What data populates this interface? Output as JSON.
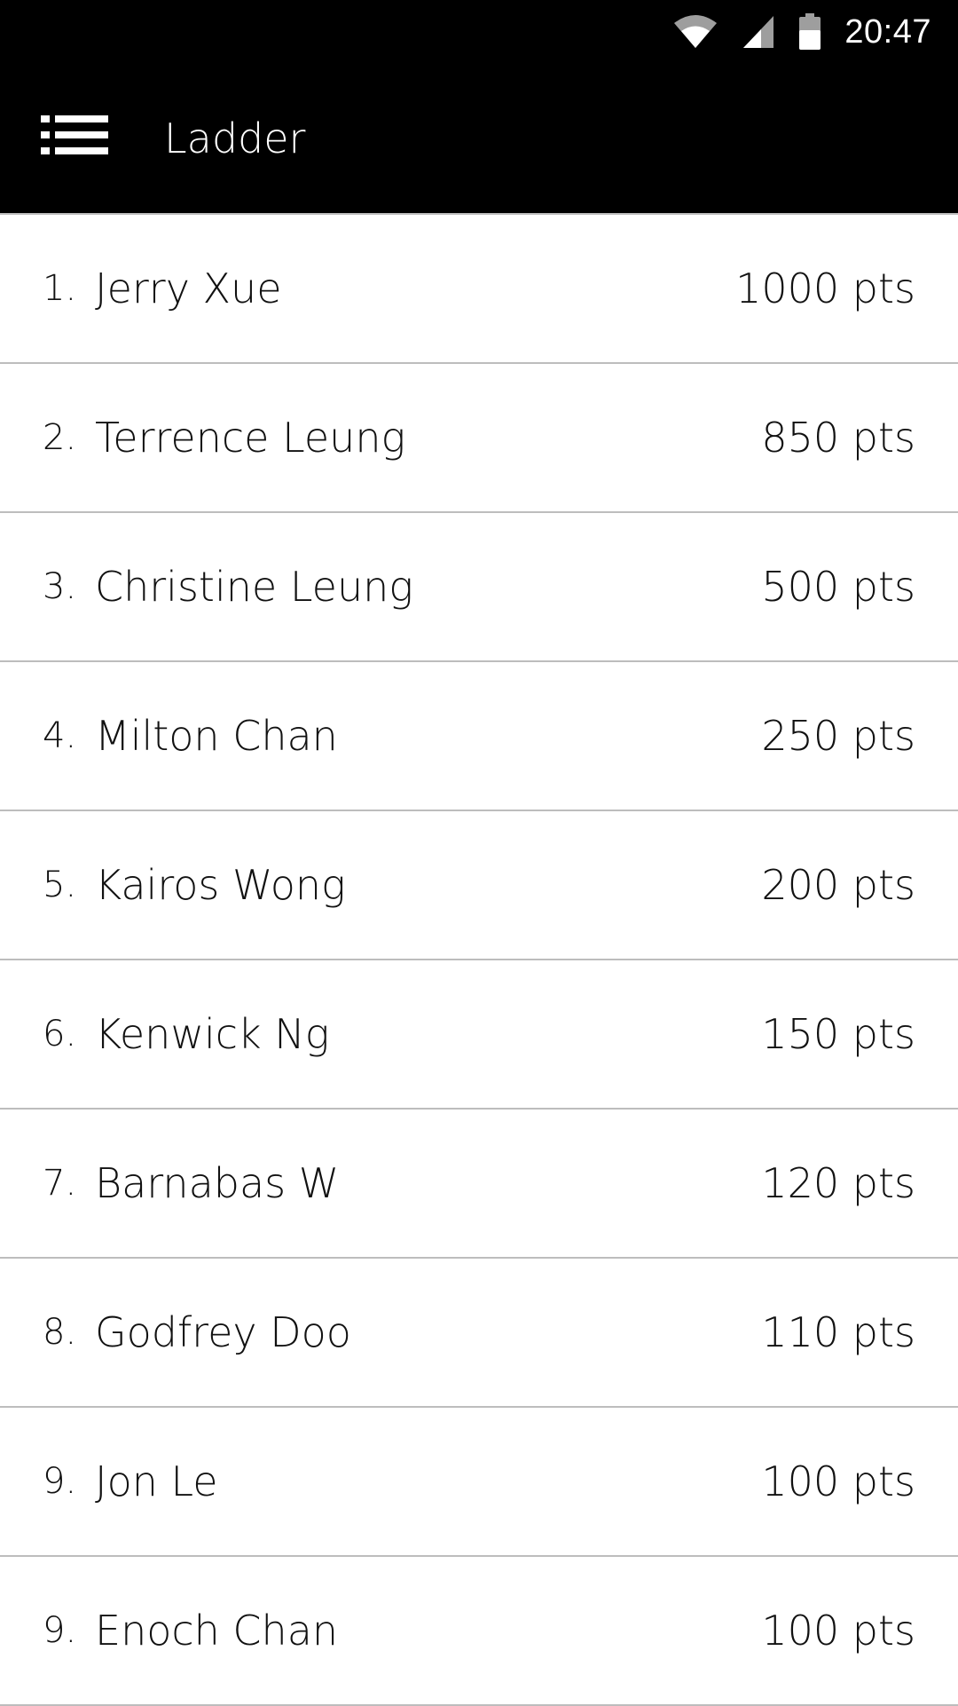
{
  "status_bar": {
    "time": "20:47",
    "icons": [
      "wifi-icon",
      "cell-signal-icon",
      "battery-icon"
    ]
  },
  "app_bar": {
    "title": "Ladder",
    "menu_icon": "list-menu-icon",
    "background": "#000000",
    "text_color": "#ffffff"
  },
  "ladder": [
    {
      "rank": "1.",
      "name": "Jerry Xue",
      "points": "1000 pts"
    },
    {
      "rank": "2.",
      "name": "Terrence Leung",
      "points": "850 pts"
    },
    {
      "rank": "3.",
      "name": "Christine Leung",
      "points": "500 pts"
    },
    {
      "rank": "4.",
      "name": "Milton Chan",
      "points": "250 pts"
    },
    {
      "rank": "5.",
      "name": "Kairos Wong",
      "points": "200 pts"
    },
    {
      "rank": "6.",
      "name": "Kenwick Ng",
      "points": "150 pts"
    },
    {
      "rank": "7.",
      "name": "Barnabas W",
      "points": "120 pts"
    },
    {
      "rank": "8.",
      "name": "Godfrey Doo",
      "points": "110 pts"
    },
    {
      "rank": "9.",
      "name": "Jon Le",
      "points": "100 pts"
    },
    {
      "rank": "9.",
      "name": "Enoch Chan",
      "points": "100 pts"
    }
  ]
}
